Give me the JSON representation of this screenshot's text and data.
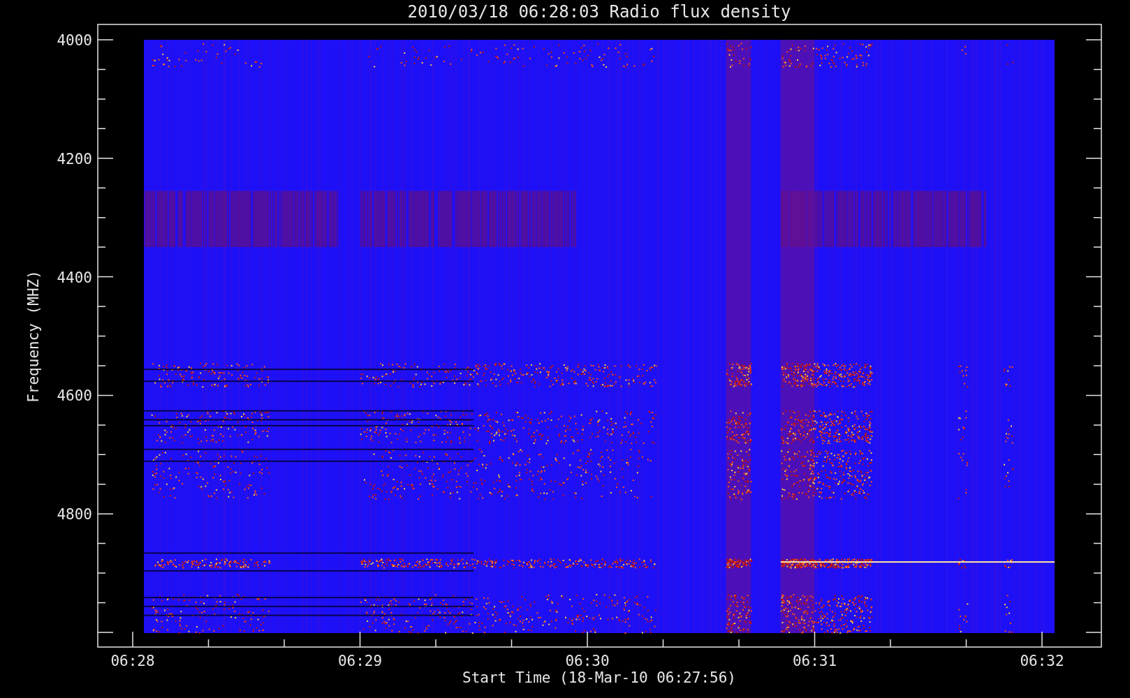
{
  "title": "2010/03/18 06:28:03 Radio flux density",
  "y_axis": {
    "label": "Frequency (MHZ)",
    "ticks": [
      "4000",
      "4200",
      "4400",
      "4600",
      "4800"
    ]
  },
  "x_axis": {
    "label": "Start Time (18-Mar-10 06:27:56)",
    "ticks": [
      "06:28",
      "06:29",
      "06:30",
      "06:31",
      "06:32"
    ]
  }
}
